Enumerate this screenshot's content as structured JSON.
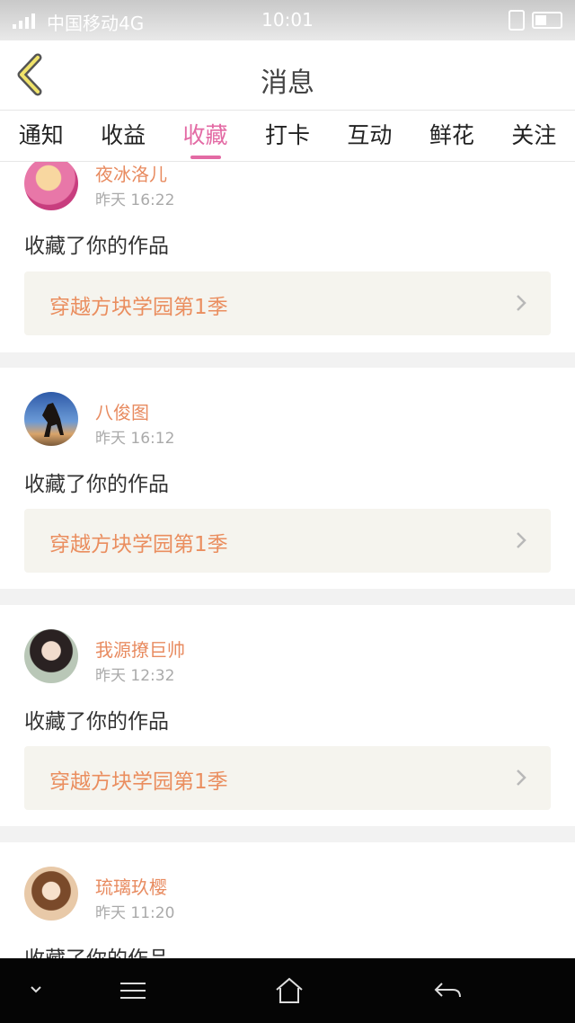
{
  "status": {
    "carrier": "中国移动4G",
    "time": "10:01"
  },
  "header": {
    "title": "消息",
    "back_icon": "chevron-left-icon"
  },
  "tabs": [
    {
      "label": "通知",
      "active": false
    },
    {
      "label": "收益",
      "active": false
    },
    {
      "label": "收藏",
      "active": true
    },
    {
      "label": "打卡",
      "active": false
    },
    {
      "label": "互动",
      "active": false
    },
    {
      "label": "鲜花",
      "active": false
    },
    {
      "label": "关注",
      "active": false
    }
  ],
  "feed": [
    {
      "user": "夜冰洛儿",
      "time": "昨天 16:22",
      "action": "收藏了你的作品",
      "work": "穿越方块学园第1季"
    },
    {
      "user": "八俊图",
      "time": "昨天 16:12",
      "action": "收藏了你的作品",
      "work": "穿越方块学园第1季"
    },
    {
      "user": "我源撩巨帅",
      "time": "昨天 12:32",
      "action": "收藏了你的作品",
      "work": "穿越方块学园第1季"
    },
    {
      "user": "琉璃玖樱",
      "time": "昨天 11:20",
      "action": "收藏了你的作品",
      "work": ""
    }
  ],
  "colors": {
    "accent": "#e36aa4",
    "username": "#e88b60",
    "work_title": "#ea8e5f"
  }
}
